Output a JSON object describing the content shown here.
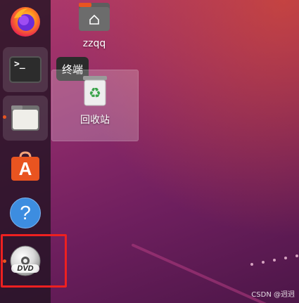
{
  "dock": {
    "items": [
      {
        "name": "firefox",
        "icon": "firefox-icon"
      },
      {
        "name": "terminal",
        "icon": "terminal-icon",
        "glyph": ">_"
      },
      {
        "name": "files",
        "icon": "folder-icon"
      },
      {
        "name": "software",
        "icon": "app-store-icon",
        "glyph": "A"
      },
      {
        "name": "help",
        "icon": "help-icon",
        "glyph": "?"
      },
      {
        "name": "dvd",
        "icon": "dvd-icon",
        "glyph": "DVD"
      }
    ]
  },
  "tooltip": {
    "text": "终端"
  },
  "desktop": {
    "home_folder": {
      "label": "zzqq"
    },
    "trash": {
      "label": "回收站"
    }
  },
  "watermark": "CSDN @迥迥",
  "colors": {
    "accent": "#e95420",
    "highlight": "#ee2020",
    "help_blue": "#3d8de0"
  }
}
